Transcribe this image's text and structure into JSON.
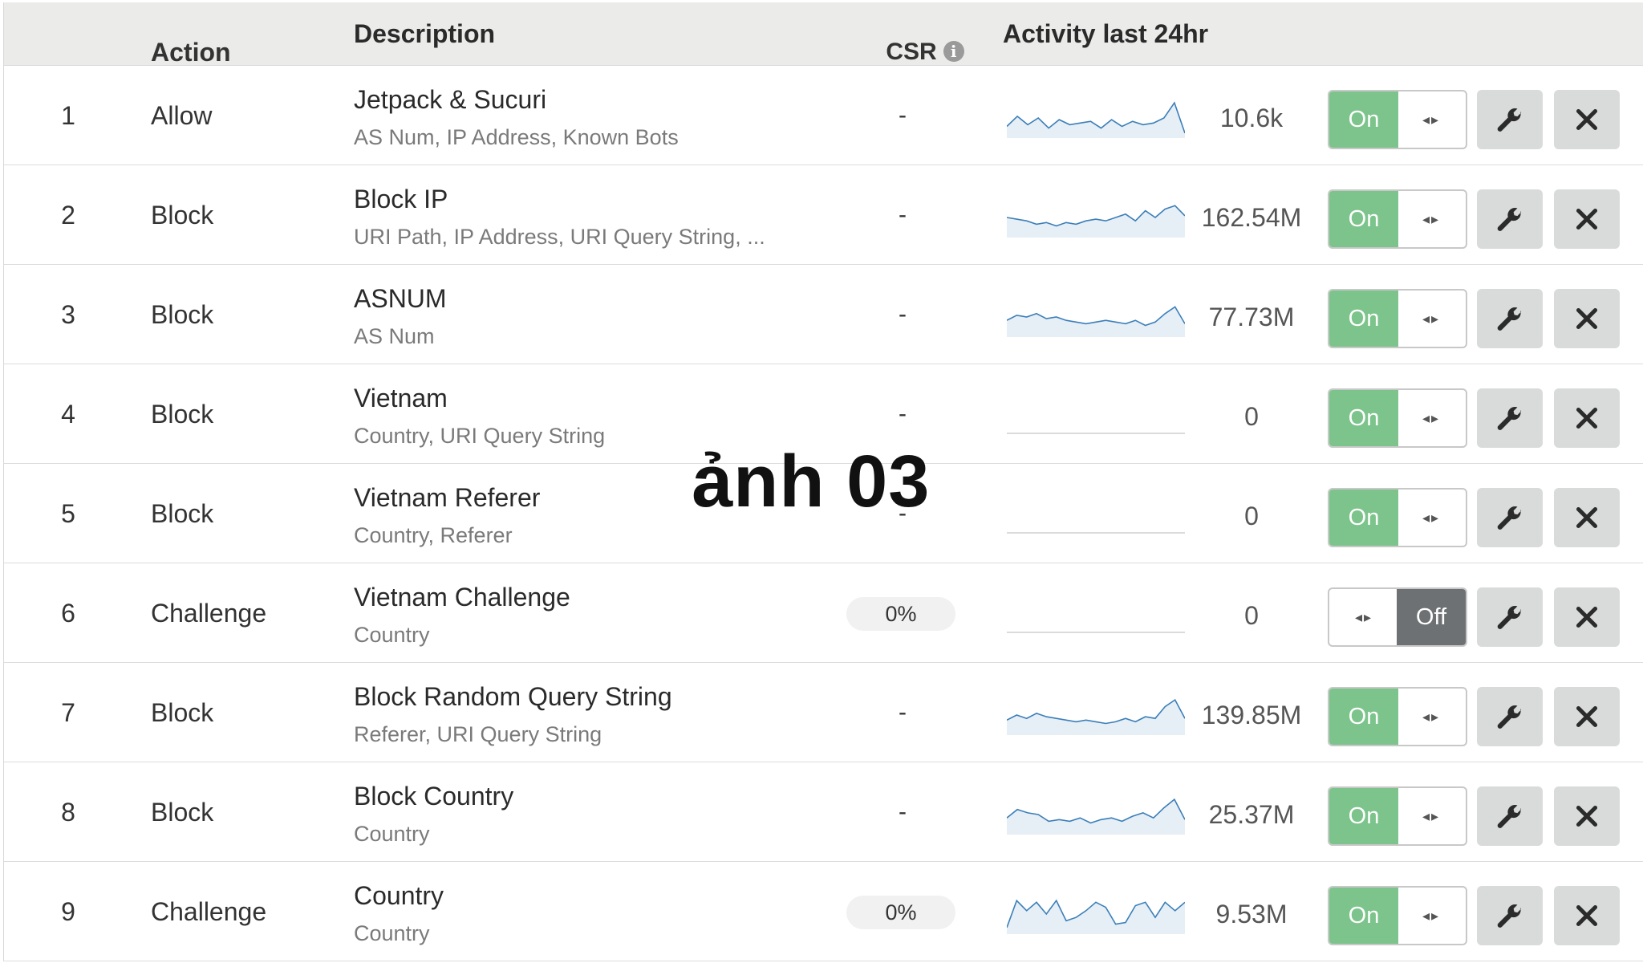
{
  "header": {
    "action": "Action",
    "description": "Description",
    "csr": "CSR",
    "activity": "Activity last 24hr"
  },
  "overlay_text": "ảnh 03",
  "rows": [
    {
      "num": "1",
      "action": "Allow",
      "title": "Jetpack & Sucuri",
      "sub": "AS Num, IP Address, Known Bots",
      "csr": "-",
      "count": "10.6k",
      "state": "On"
    },
    {
      "num": "2",
      "action": "Block",
      "title": "Block IP",
      "sub": "URI Path, IP Address, URI Query String, ...",
      "csr": "-",
      "count": "162.54M",
      "state": "On"
    },
    {
      "num": "3",
      "action": "Block",
      "title": "ASNUM",
      "sub": "AS Num",
      "csr": "-",
      "count": "77.73M",
      "state": "On"
    },
    {
      "num": "4",
      "action": "Block",
      "title": "Vietnam",
      "sub": "Country, URI Query String",
      "csr": "-",
      "count": "0",
      "state": "On"
    },
    {
      "num": "5",
      "action": "Block",
      "title": "Vietnam Referer",
      "sub": "Country, Referer",
      "csr": "-",
      "count": "0",
      "state": "On"
    },
    {
      "num": "6",
      "action": "Challenge",
      "title": "Vietnam Challenge",
      "sub": "Country",
      "csr": "0%",
      "count": "0",
      "state": "Off"
    },
    {
      "num": "7",
      "action": "Block",
      "title": "Block Random Query String",
      "sub": "Referer, URI Query String",
      "csr": "-",
      "count": "139.85M",
      "state": "On"
    },
    {
      "num": "8",
      "action": "Block",
      "title": "Block Country",
      "sub": "Country",
      "csr": "-",
      "count": "25.37M",
      "state": "On"
    },
    {
      "num": "9",
      "action": "Challenge",
      "title": "Country",
      "sub": "Country",
      "csr": "0%",
      "count": "9.53M",
      "state": "On"
    }
  ],
  "sparklines": [
    [
      0.25,
      0.55,
      0.3,
      0.5,
      0.2,
      0.45,
      0.3,
      0.35,
      0.4,
      0.2,
      0.45,
      0.25,
      0.4,
      0.3,
      0.35,
      0.5,
      0.95,
      0.05
    ],
    [
      0.5,
      0.45,
      0.4,
      0.3,
      0.35,
      0.25,
      0.35,
      0.3,
      0.4,
      0.45,
      0.4,
      0.5,
      0.6,
      0.4,
      0.7,
      0.5,
      0.75,
      0.85,
      0.55
    ],
    [
      0.4,
      0.55,
      0.5,
      0.6,
      0.45,
      0.5,
      0.4,
      0.35,
      0.3,
      0.35,
      0.4,
      0.35,
      0.3,
      0.4,
      0.25,
      0.35,
      0.6,
      0.8,
      0.3
    ],
    [
      0,
      0,
      0,
      0,
      0,
      0,
      0,
      0,
      0,
      0,
      0,
      0,
      0,
      0,
      0,
      0,
      0,
      0,
      0
    ],
    [
      0,
      0,
      0,
      0,
      0,
      0,
      0,
      0,
      0,
      0,
      0,
      0,
      0,
      0,
      0,
      0,
      0,
      0,
      0
    ],
    [
      0,
      0,
      0,
      0,
      0,
      0,
      0,
      0,
      0,
      0,
      0,
      0,
      0,
      0,
      0,
      0,
      0,
      0,
      0
    ],
    [
      0.35,
      0.5,
      0.4,
      0.55,
      0.45,
      0.4,
      0.35,
      0.3,
      0.35,
      0.3,
      0.25,
      0.3,
      0.4,
      0.3,
      0.45,
      0.4,
      0.75,
      0.95,
      0.4
    ],
    [
      0.4,
      0.65,
      0.55,
      0.5,
      0.3,
      0.35,
      0.3,
      0.4,
      0.25,
      0.35,
      0.4,
      0.3,
      0.45,
      0.55,
      0.4,
      0.7,
      0.95,
      0.35
    ],
    [
      0.1,
      0.9,
      0.6,
      0.85,
      0.5,
      0.9,
      0.3,
      0.4,
      0.6,
      0.85,
      0.7,
      0.2,
      0.25,
      0.75,
      0.85,
      0.4,
      0.85,
      0.6,
      0.85
    ]
  ],
  "colors": {
    "toggle_on": "#7cc48b",
    "toggle_off": "#6e7173",
    "spark_line": "#3b7fb8",
    "spark_fill": "#e6eef6",
    "button_bg": "#d9dbdb"
  }
}
